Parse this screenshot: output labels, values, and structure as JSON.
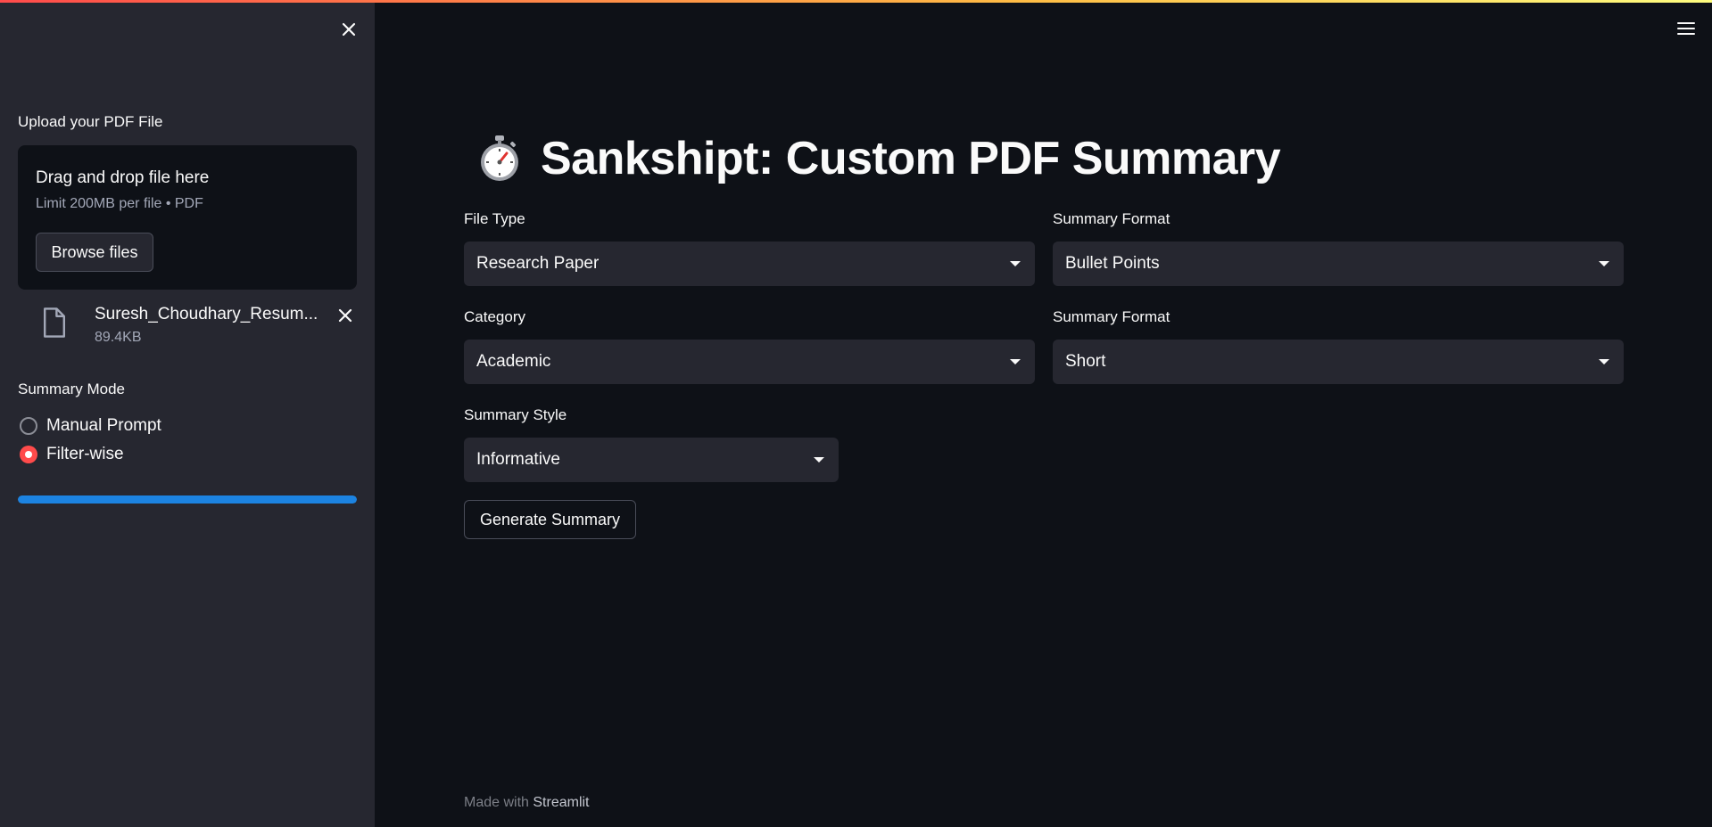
{
  "sidebar": {
    "uploader": {
      "label": "Upload your PDF File",
      "drop_text": "Drag and drop file here",
      "limit_text": "Limit 200MB per file • PDF",
      "browse_label": "Browse files"
    },
    "uploaded_file": {
      "name": "Suresh_Choudhary_Resum...",
      "size": "89.4KB"
    },
    "summary_mode": {
      "label": "Summary Mode",
      "options": [
        {
          "label": "Manual Prompt",
          "selected": false
        },
        {
          "label": "Filter-wise",
          "selected": true
        }
      ]
    },
    "progress": {
      "value_percent": 100,
      "color": "#1c83e1"
    }
  },
  "main": {
    "title": "Sankshipt: Custom PDF Summary",
    "title_icon": "stopwatch-icon",
    "fields": {
      "file_type": {
        "label": "File Type",
        "value": "Research Paper"
      },
      "summary_format_1": {
        "label": "Summary Format",
        "value": "Bullet Points"
      },
      "category": {
        "label": "Category",
        "value": "Academic"
      },
      "summary_format_2": {
        "label": "Summary Format",
        "value": "Short"
      },
      "summary_style": {
        "label": "Summary Style",
        "value": "Informative"
      }
    },
    "generate_label": "Generate Summary"
  },
  "footer": {
    "prefix": "Made with ",
    "link": "Streamlit"
  },
  "colors": {
    "background": "#0e1117",
    "sidebar": "#262730",
    "accent": "#ff4b4b",
    "progress": "#1c83e1"
  }
}
